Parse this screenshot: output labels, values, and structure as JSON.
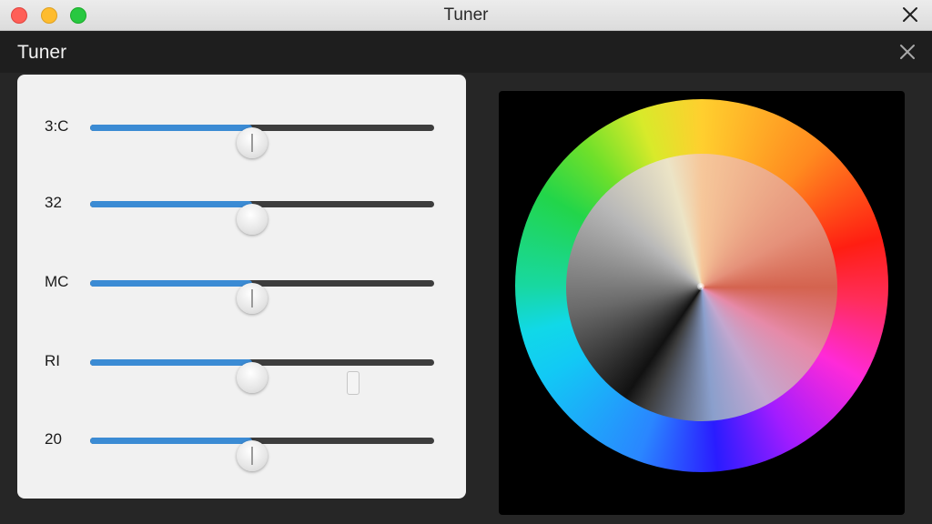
{
  "window": {
    "title": "Tuner"
  },
  "app": {
    "title": "Tuner"
  },
  "sliders": [
    {
      "label": "3:C",
      "value": 0.47
    },
    {
      "label": "32",
      "value": 0.47
    },
    {
      "label": "MC",
      "value": 0.47
    },
    {
      "label": "RI",
      "value": 0.47
    },
    {
      "label": "20",
      "value": 0.47
    }
  ],
  "colors": {
    "accent": "#3b8bd4",
    "panel": "#f1f1f1",
    "app_background": "#262626",
    "wheel_background": "#000000"
  },
  "icons": {
    "window_close": "close-icon",
    "app_close": "close-icon"
  }
}
